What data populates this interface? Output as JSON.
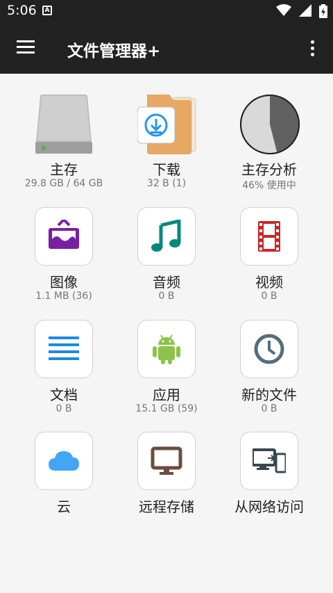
{
  "status_bar": {
    "time": "5:06",
    "notification_icon_letter": "A"
  },
  "app_bar": {
    "title": "文件管理器+"
  },
  "tiles": [
    {
      "label": "主存",
      "sub": "29.8 GB / 64 GB",
      "icon": "hard-drive-icon"
    },
    {
      "label": "下载",
      "sub": "32 B (1)",
      "icon": "download-folder-icon"
    },
    {
      "label": "主存分析",
      "sub": "46% 使用中",
      "icon": "pie-chart-icon",
      "used_fraction": 0.46
    },
    {
      "label": "图像",
      "sub": "1.1 MB (36)",
      "icon": "image-icon",
      "color": "#7b1fa2"
    },
    {
      "label": "音频",
      "sub": "0 B",
      "icon": "music-note-icon",
      "color": "#00897b"
    },
    {
      "label": "视频",
      "sub": "0 B",
      "icon": "film-icon",
      "color": "#c62828"
    },
    {
      "label": "文档",
      "sub": "0 B",
      "icon": "document-icon",
      "color": "#1e88e5"
    },
    {
      "label": "应用",
      "sub": "15.1 GB (59)",
      "icon": "android-icon",
      "color": "#8bc34a"
    },
    {
      "label": "新的文件",
      "sub": "0 B",
      "icon": "clock-icon",
      "color": "#546e7a"
    },
    {
      "label": "云",
      "sub": "",
      "icon": "cloud-icon",
      "color": "#42a5f5"
    },
    {
      "label": "远程存储",
      "sub": "",
      "icon": "monitor-icon",
      "color": "#6d4c41"
    },
    {
      "label": "从网络访问",
      "sub": "",
      "icon": "devices-icon",
      "color": "#37474f"
    }
  ]
}
